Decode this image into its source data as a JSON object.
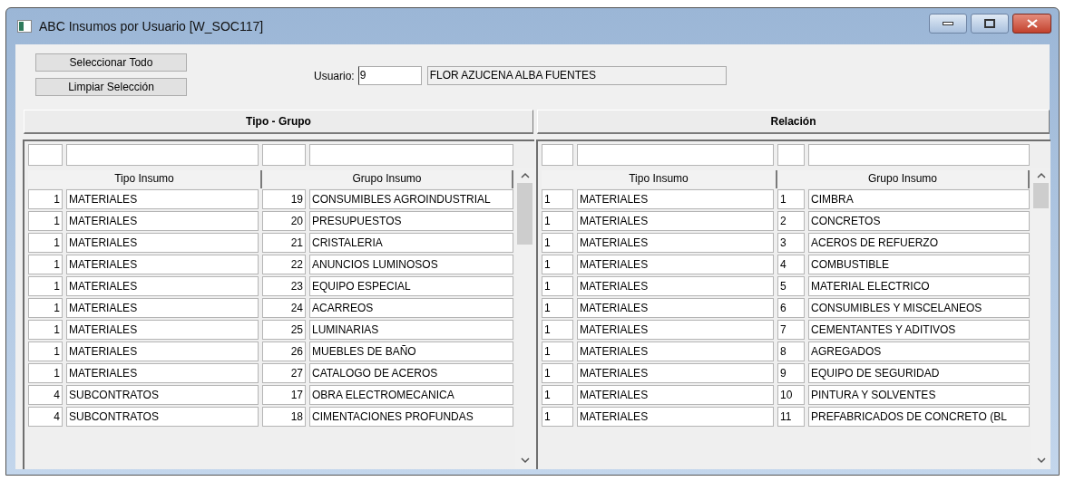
{
  "window": {
    "title": "ABC Insumos por Usuario [W_SOC117]"
  },
  "buttons": [
    "Seleccionar Todo",
    "Limpiar Selección"
  ],
  "user": {
    "label": "Usuario:",
    "id": "9",
    "name": "FLOR AZUCENA ALBA FUENTES"
  },
  "tables": [
    {
      "title": "Tipo - Grupo",
      "columns": [
        "Tipo Insumo",
        "Grupo Insumo"
      ],
      "rows": [
        {
          "tipo": {
            "id": "1",
            "name": "MATERIALES"
          },
          "grupo": {
            "id": "19",
            "name": "CONSUMIBLES AGROINDUSTRIAL"
          }
        },
        {
          "tipo": {
            "id": "1",
            "name": "MATERIALES"
          },
          "grupo": {
            "id": "20",
            "name": "PRESUPUESTOS"
          }
        },
        {
          "tipo": {
            "id": "1",
            "name": "MATERIALES"
          },
          "grupo": {
            "id": "21",
            "name": "CRISTALERIA"
          }
        },
        {
          "tipo": {
            "id": "1",
            "name": "MATERIALES"
          },
          "grupo": {
            "id": "22",
            "name": "ANUNCIOS LUMINOSOS"
          }
        },
        {
          "tipo": {
            "id": "1",
            "name": "MATERIALES"
          },
          "grupo": {
            "id": "23",
            "name": "EQUIPO ESPECIAL"
          }
        },
        {
          "tipo": {
            "id": "1",
            "name": "MATERIALES"
          },
          "grupo": {
            "id": "24",
            "name": "ACARREOS"
          }
        },
        {
          "tipo": {
            "id": "1",
            "name": "MATERIALES"
          },
          "grupo": {
            "id": "25",
            "name": "LUMINARIAS"
          }
        },
        {
          "tipo": {
            "id": "1",
            "name": "MATERIALES"
          },
          "grupo": {
            "id": "26",
            "name": "MUEBLES DE BAÑO"
          }
        },
        {
          "tipo": {
            "id": "1",
            "name": "MATERIALES"
          },
          "grupo": {
            "id": "27",
            "name": "CATALOGO DE ACEROS"
          }
        },
        {
          "tipo": {
            "id": "4",
            "name": "SUBCONTRATOS"
          },
          "grupo": {
            "id": "17",
            "name": "OBRA ELECTROMECANICA"
          }
        },
        {
          "tipo": {
            "id": "4",
            "name": "SUBCONTRATOS"
          },
          "grupo": {
            "id": "18",
            "name": "CIMENTACIONES PROFUNDAS"
          }
        }
      ]
    },
    {
      "title": "Relación",
      "columns": [
        "Tipo Insumo",
        "Grupo Insumo"
      ],
      "rows": [
        {
          "tipo": {
            "id": "1",
            "name": "MATERIALES"
          },
          "grupo": {
            "id": "1",
            "name": "CIMBRA"
          }
        },
        {
          "tipo": {
            "id": "1",
            "name": "MATERIALES"
          },
          "grupo": {
            "id": "2",
            "name": "CONCRETOS"
          }
        },
        {
          "tipo": {
            "id": "1",
            "name": "MATERIALES"
          },
          "grupo": {
            "id": "3",
            "name": "ACEROS DE REFUERZO"
          }
        },
        {
          "tipo": {
            "id": "1",
            "name": "MATERIALES"
          },
          "grupo": {
            "id": "4",
            "name": "COMBUSTIBLE"
          }
        },
        {
          "tipo": {
            "id": "1",
            "name": "MATERIALES"
          },
          "grupo": {
            "id": "5",
            "name": "MATERIAL ELECTRICO"
          }
        },
        {
          "tipo": {
            "id": "1",
            "name": "MATERIALES"
          },
          "grupo": {
            "id": "6",
            "name": "CONSUMIBLES Y MISCELANEOS"
          }
        },
        {
          "tipo": {
            "id": "1",
            "name": "MATERIALES"
          },
          "grupo": {
            "id": "7",
            "name": "CEMENTANTES Y ADITIVOS"
          }
        },
        {
          "tipo": {
            "id": "1",
            "name": "MATERIALES"
          },
          "grupo": {
            "id": "8",
            "name": "AGREGADOS"
          }
        },
        {
          "tipo": {
            "id": "1",
            "name": "MATERIALES"
          },
          "grupo": {
            "id": "9",
            "name": "EQUIPO DE SEGURIDAD"
          }
        },
        {
          "tipo": {
            "id": "1",
            "name": "MATERIALES"
          },
          "grupo": {
            "id": "10",
            "name": "PINTURA Y SOLVENTES"
          }
        },
        {
          "tipo": {
            "id": "1",
            "name": "MATERIALES"
          },
          "grupo": {
            "id": "11",
            "name": "PREFABRICADOS DE CONCRETO (BL"
          }
        }
      ]
    }
  ]
}
